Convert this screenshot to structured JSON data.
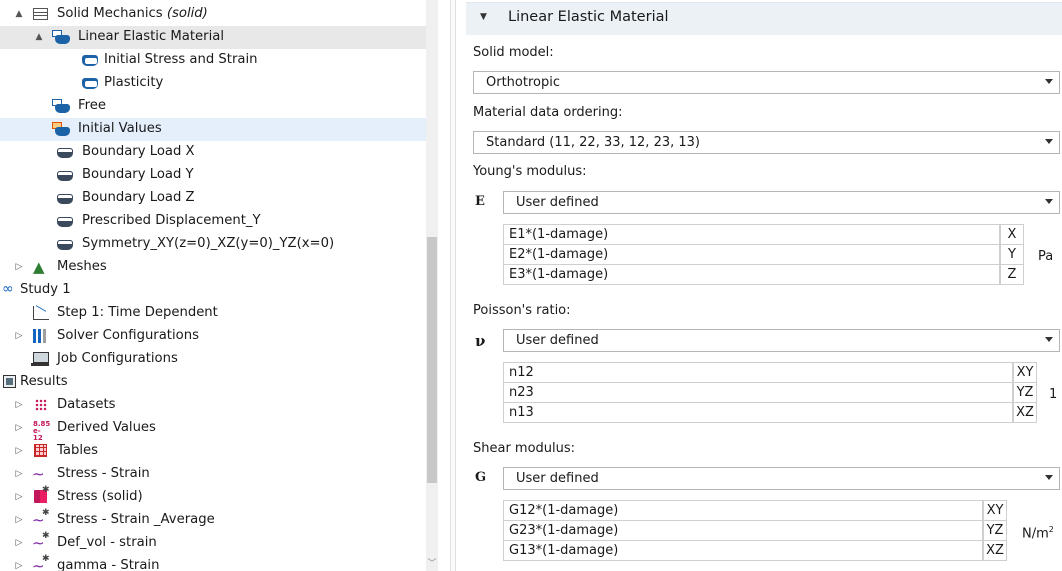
{
  "tree": {
    "items": [
      {
        "label": "Solid Mechanics",
        "suffix": "(solid)",
        "arrow": "▲",
        "icon": "solid-mechanics-icon"
      },
      {
        "label": "Linear Elastic Material",
        "arrow": "▲",
        "icon": "linear-elastic-icon"
      },
      {
        "label": "Initial Stress and Strain",
        "icon": "subnode-icon"
      },
      {
        "label": "Plasticity",
        "icon": "subnode-icon"
      },
      {
        "label": "Free",
        "icon": "free-icon"
      },
      {
        "label": "Initial Values",
        "icon": "initial-values-icon"
      },
      {
        "label": "Boundary Load X",
        "icon": "boundary-icon"
      },
      {
        "label": "Boundary Load Y",
        "icon": "boundary-icon"
      },
      {
        "label": "Boundary Load Z",
        "icon": "boundary-icon"
      },
      {
        "label": "Prescribed Displacement_Y",
        "icon": "boundary-icon"
      },
      {
        "label": "Symmetry_XY(z=0)_XZ(y=0)_YZ(x=0)",
        "icon": "boundary-icon"
      },
      {
        "label": "Meshes",
        "arrow": "▷",
        "icon": "meshes-icon"
      },
      {
        "label": "Study 1",
        "icon": "study-icon"
      },
      {
        "label": "Step 1: Time Dependent",
        "icon": "time-dependent-icon"
      },
      {
        "label": "Solver Configurations",
        "arrow": "▷",
        "icon": "solver-icon"
      },
      {
        "label": "Job Configurations",
        "icon": "job-icon"
      },
      {
        "label": "Results",
        "icon": "results-icon"
      },
      {
        "label": "Datasets",
        "arrow": "▷",
        "icon": "datasets-icon"
      },
      {
        "label": "Derived Values",
        "arrow": "▷",
        "icon": "derived-values-icon"
      },
      {
        "label": "Tables",
        "arrow": "▷",
        "icon": "tables-icon"
      },
      {
        "label": "Stress - Strain",
        "arrow": "▷",
        "icon": "plot-1d-icon"
      },
      {
        "label": "Stress (solid)",
        "arrow": "▷",
        "icon": "plot-3d-icon"
      },
      {
        "label": "Stress - Strain _Average",
        "arrow": "▷",
        "icon": "plot-1d-icon"
      },
      {
        "label": "Def_vol - strain",
        "arrow": "▷",
        "icon": "plot-1d-icon"
      },
      {
        "label": "gamma - Strain",
        "arrow": "▷",
        "icon": "plot-1d-icon"
      }
    ],
    "derived_values_badge_top": "8.85",
    "derived_values_badge_bottom": "e-12"
  },
  "settings": {
    "section_title": "Linear Elastic Material",
    "solid_model_label": "Solid model:",
    "solid_model_value": "Orthotropic",
    "ordering_label": "Material data ordering:",
    "ordering_value": "Standard (11, 22, 33, 12, 23, 13)",
    "youngs": {
      "label": "Young's modulus:",
      "symbol": "E",
      "source": "User defined",
      "rows": [
        {
          "value": "E1*(1-damage)",
          "tag": "X"
        },
        {
          "value": "E2*(1-damage)",
          "tag": "Y"
        },
        {
          "value": "E3*(1-damage)",
          "tag": "Z"
        }
      ],
      "unit": "Pa"
    },
    "poisson": {
      "label": "Poisson's ratio:",
      "symbol": "ν",
      "source": "User defined",
      "rows": [
        {
          "value": "n12",
          "tag": "XY"
        },
        {
          "value": "n23",
          "tag": "YZ"
        },
        {
          "value": "n13",
          "tag": "XZ"
        }
      ],
      "unit": "1"
    },
    "shear": {
      "label": "Shear modulus:",
      "symbol": "G",
      "source": "User defined",
      "rows": [
        {
          "value": "G12*(1-damage)",
          "tag": "XY"
        },
        {
          "value": "G23*(1-damage)",
          "tag": "YZ"
        },
        {
          "value": "G13*(1-damage)",
          "tag": "XZ"
        }
      ],
      "unit": "N/m",
      "unit_sup": "2"
    }
  }
}
